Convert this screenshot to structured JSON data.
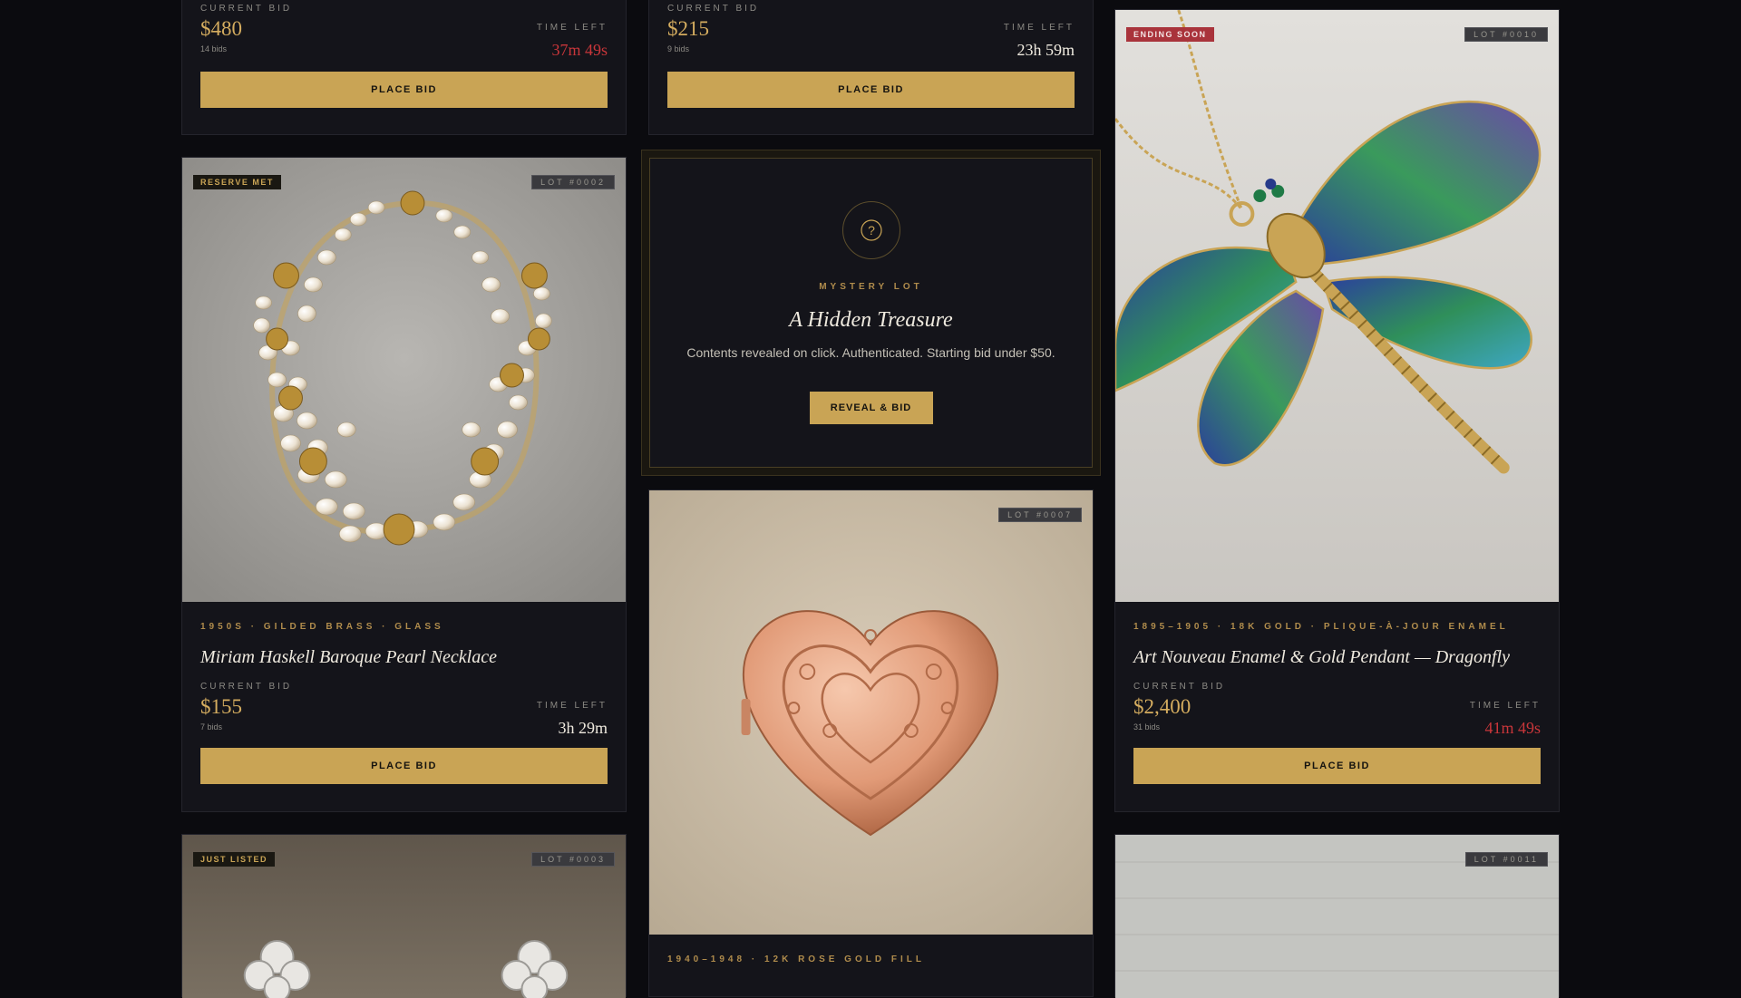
{
  "top_cards": [
    {
      "current_bid_label": "CURRENT BID",
      "current_bid": "$480",
      "bids": "14 bids",
      "time_left_label": "TIME LEFT",
      "time_left": "37m 49s",
      "button": "PLACE BID"
    },
    {
      "current_bid_label": "CURRENT BID",
      "current_bid": "$215",
      "bids": "9 bids",
      "time_left_label": "TIME LEFT",
      "time_left": "23h 59m",
      "button": "PLACE BID"
    }
  ],
  "lots": [
    {
      "badge": "RESERVE MET",
      "lot": "LOT #0002",
      "meta": "1950S · GILDED BRASS · GLASS",
      "title": "Miriam Haskell Baroque Pearl Necklace",
      "current_bid_label": "CURRENT BID",
      "current_bid": "$155",
      "bids": "7 bids",
      "time_left_label": "TIME LEFT",
      "time_left": "3h 29m",
      "button": "PLACE BID"
    },
    {
      "badge": "ENDING SOON",
      "lot": "LOT #0010",
      "meta": "1895–1905 · 18K GOLD · PLIQUE-À-JOUR ENAMEL",
      "title": "Art Nouveau Enamel & Gold Pendant — Dragonfly",
      "current_bid_label": "CURRENT BID",
      "current_bid": "$2,400",
      "bids": "31 bids",
      "time_left_label": "TIME LEFT",
      "time_left": "41m 49s",
      "button": "PLACE BID"
    },
    {
      "lot": "LOT #0007",
      "meta": "1940–1948 · 12K ROSE GOLD FILL"
    },
    {
      "badge": "JUST LISTED",
      "lot": "LOT #0003"
    },
    {
      "lot": "LOT #0011"
    }
  ],
  "mystery": {
    "icon": "question-icon",
    "label": "MYSTERY LOT",
    "title": "A Hidden Treasure",
    "description": "Contents revealed on click. Authenticated. Starting bid under $50.",
    "button": "REVEAL & BID"
  },
  "colors": {
    "accent": "#c9a455",
    "urgent": "#c9363a",
    "background": "#0b0b0f",
    "card": "#14141a"
  }
}
